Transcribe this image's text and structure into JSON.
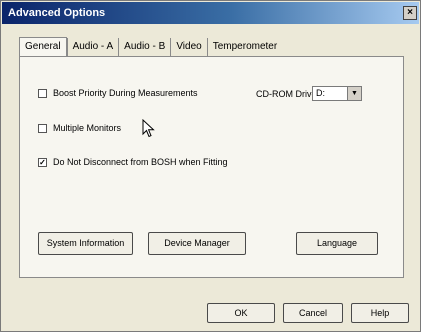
{
  "window": {
    "title": "Advanced Options",
    "close_label": "×"
  },
  "tabs": [
    {
      "label": "General"
    },
    {
      "label": "Audio - A"
    },
    {
      "label": "Audio - B"
    },
    {
      "label": "Video"
    },
    {
      "label": "Temperometer"
    }
  ],
  "general": {
    "boost_priority_label": "Boost Priority During Measurements",
    "boost_priority_checked": false,
    "multiple_monitors_label": "Multiple Monitors",
    "multiple_monitors_checked": false,
    "do_not_disconnect_label": "Do Not Disconnect from BOSH when Fitting",
    "do_not_disconnect_checked": true,
    "check_mark": "✓",
    "cdrom_label": "CD-ROM Drive",
    "cdrom_value": "D:",
    "select_arrow": "▼",
    "system_info_label": "System Information",
    "device_manager_label": "Device Manager",
    "language_label": "Language"
  },
  "footer": {
    "ok_label": "OK",
    "cancel_label": "Cancel",
    "help_label": "Help"
  }
}
